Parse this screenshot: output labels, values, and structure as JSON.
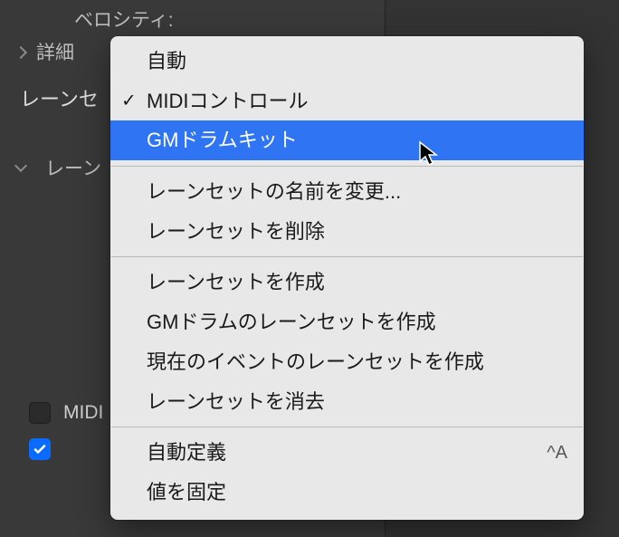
{
  "bg": {
    "velocity_label": "ベロシティ:",
    "detail_label": "詳細",
    "laneset_label_partial_1": "レーンセ",
    "laneset_label_partial_2": "レーン",
    "midi_label_partial": "MIDI"
  },
  "menu": {
    "items": [
      {
        "label": "自動",
        "checked": false
      },
      {
        "label": "MIDIコントロール",
        "checked": true
      },
      {
        "label": "GMドラムキット",
        "checked": false,
        "selected": true
      }
    ],
    "group2": [
      {
        "label": "レーンセットの名前を変更..."
      },
      {
        "label": "レーンセットを削除"
      }
    ],
    "group3": [
      {
        "label": "レーンセットを作成"
      },
      {
        "label": "GMドラムのレーンセットを作成"
      },
      {
        "label": "現在のイベントのレーンセットを作成"
      },
      {
        "label": "レーンセットを消去"
      }
    ],
    "group4": [
      {
        "label": "自動定義",
        "shortcut": "^A"
      },
      {
        "label": "値を固定"
      }
    ]
  }
}
